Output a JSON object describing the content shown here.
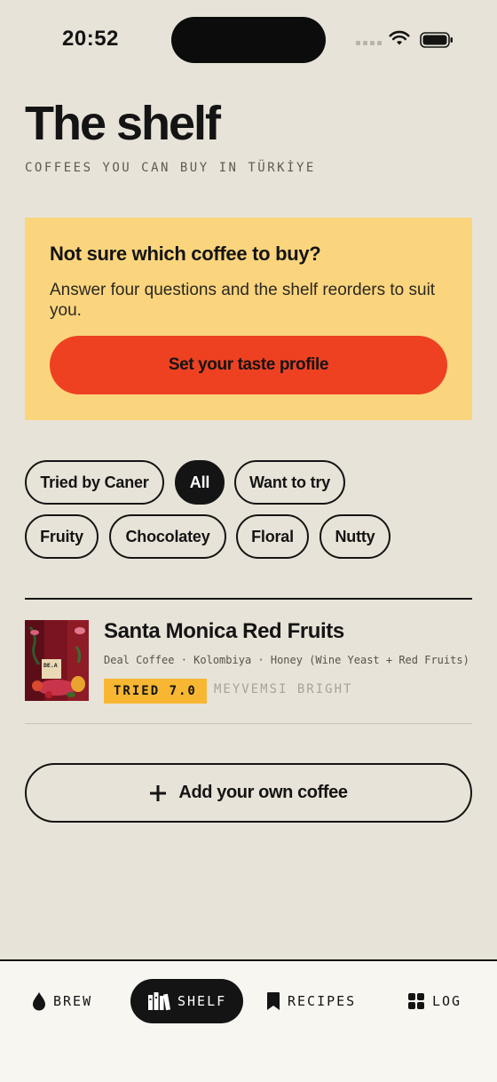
{
  "status_bar": {
    "time": "20:52"
  },
  "header": {
    "title": "The shelf",
    "subtitle": "COFFEES YOU CAN BUY IN TÜRKİYE"
  },
  "promo": {
    "title": "Not sure which coffee to buy?",
    "text": "Answer four questions and the shelf reorders to suit you.",
    "button_label": "Set your taste profile",
    "background_color": "#fbd57e",
    "button_color": "#ee4122"
  },
  "filters": {
    "row1": [
      {
        "label": "Tried by Caner",
        "active": false
      },
      {
        "label": "All",
        "active": true
      },
      {
        "label": "Want to try",
        "active": false
      }
    ],
    "row2": [
      {
        "label": "Fruity",
        "active": false
      },
      {
        "label": "Chocolatey",
        "active": false
      },
      {
        "label": "Floral",
        "active": false
      },
      {
        "label": "Nutty",
        "active": false
      }
    ]
  },
  "coffees": [
    {
      "name": "Santa Monica Red Fruits",
      "meta": "Deal Coffee · Kolombiya · Honey (Wine Yeast + Red Fruits)",
      "badge": "TRIED 7.0",
      "tags": "MEYVEMSI BRIGHT",
      "thumb_label": "DE.A",
      "badge_color": "#f7b733"
    }
  ],
  "add_button": {
    "label": "Add your own coffee",
    "icon": "plus-icon"
  },
  "tab_bar": {
    "tabs": [
      {
        "label": "BREW",
        "icon": "drop-icon",
        "active": false
      },
      {
        "label": "SHELF",
        "icon": "books-icon",
        "active": true
      },
      {
        "label": "RECIPES",
        "icon": "bookmark-icon",
        "active": false
      },
      {
        "label": "LOG",
        "icon": "grid-icon",
        "active": false
      }
    ]
  }
}
